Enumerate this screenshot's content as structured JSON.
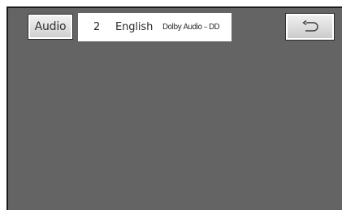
{
  "audio_button": {
    "label": "Audio"
  },
  "info_panel": {
    "track_number": "2",
    "language": "English",
    "format": "Dolby Audio – DD"
  },
  "back_button": {
    "icon": "return-arrow-icon"
  }
}
